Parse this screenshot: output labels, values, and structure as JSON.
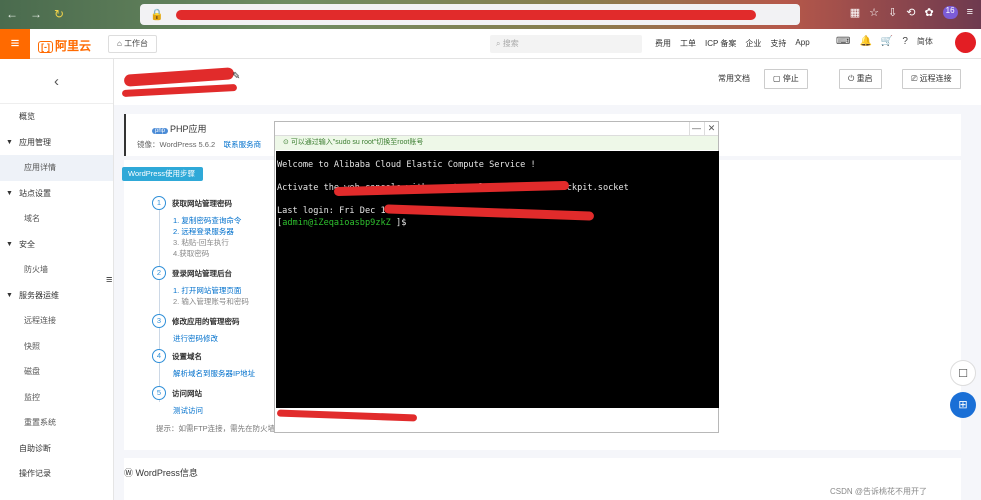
{
  "browser": {
    "nav_icons": [
      "back-arrow",
      "forward-arrow",
      "reload"
    ],
    "badge_count": "16"
  },
  "topbar": {
    "menu_icon": "≡",
    "logo_text": "阿里云",
    "workbench_label": "工作台",
    "search_placeholder": "搜索",
    "menu": [
      "费用",
      "工单",
      "ICP 备案",
      "企业",
      "支持",
      "App"
    ],
    "lang_label": "简体"
  },
  "sidebar": {
    "items": [
      {
        "label": "概览",
        "type": "item"
      },
      {
        "label": "应用管理",
        "type": "group"
      },
      {
        "label": "应用详情",
        "type": "sub"
      },
      {
        "label": "站点设置",
        "type": "group"
      },
      {
        "label": "域名",
        "type": "sub"
      },
      {
        "label": "安全",
        "type": "group"
      },
      {
        "label": "防火墙",
        "type": "sub"
      },
      {
        "label": "服务器运维",
        "type": "group"
      },
      {
        "label": "远程连接",
        "type": "sub"
      },
      {
        "label": "快照",
        "type": "sub"
      },
      {
        "label": "磁盘",
        "type": "sub"
      },
      {
        "label": "监控",
        "type": "sub"
      },
      {
        "label": "重置系统",
        "type": "sub"
      },
      {
        "label": "自助诊断",
        "type": "item"
      },
      {
        "label": "操作记录",
        "type": "item"
      }
    ]
  },
  "header": {
    "docs_label": "常用文档",
    "stop_label": "停止",
    "restart_label": "重启",
    "remote_label": "远程连接"
  },
  "app_card": {
    "title": "PHP应用",
    "mirror_label": "镜像：WordPress 5.6.2",
    "contact_link": "联系服务商"
  },
  "wordpress_steps": {
    "tag": "WordPress使用步骤",
    "steps": [
      {
        "num": "1",
        "title": "获取网站管理密码",
        "subs": [
          "1. 复制密码查询命令",
          "2. 远程登录服务器",
          "3. 粘贴-回车执行",
          "4.获取密码"
        ]
      },
      {
        "num": "2",
        "title": "登录网站管理后台",
        "subs": [
          "1. 打开网站管理页面",
          "2. 输入管理账号和密码"
        ]
      },
      {
        "num": "3",
        "title": "修改应用的管理密码",
        "subs": [
          "进行密码修改"
        ]
      },
      {
        "num": "4",
        "title": "设置域名",
        "subs": [
          "解析域名到服务器IP地址"
        ]
      },
      {
        "num": "5",
        "title": "访问网站",
        "subs": [
          "测试访问"
        ]
      }
    ],
    "tip": "提示：如需FTP连接，需先在防火墙"
  },
  "wp_info": {
    "title": "WordPress信息"
  },
  "terminal": {
    "tip": "可以通过输入\"sudo su root\"切换至root账号",
    "minimize": "—",
    "close": "✕",
    "lines": [
      "Welcome to Alibaba Cloud Elastic Compute Service !",
      "",
      "Activate the web console with: systemctl enable --now cockpit.socket",
      "",
      "Last login: Fri Dec 1"
    ],
    "prompt_open": "[",
    "prompt_user": "admin@iZeqaioasbp9zkZ",
    "prompt_close": " ]$"
  },
  "watermark": "CSDN @告诉桃花不用开了",
  "colors": {
    "brand": "#ff6a00",
    "link": "#0070cc",
    "terminal_bg": "#000000",
    "prompt_green": "#2ec12e"
  }
}
